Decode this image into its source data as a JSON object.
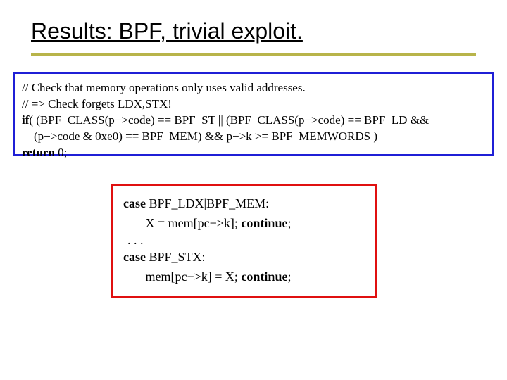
{
  "title": "Results: BPF, trivial exploit.",
  "blue": {
    "c1": "// Check that memory operations only uses valid addresses.",
    "c2": "// => Check forgets LDX,STX!",
    "if": "if",
    "cond1": "( (BPF_CLASS(p−>code) == BPF_ST || (BPF_CLASS(p−>code) == BPF_LD &&",
    "cond2": "    (p−>code & 0xe0) == BPF_MEM) && p−>k >= BPF_MEMWORDS )",
    "ret": "return",
    "retv": " 0;"
  },
  "red": {
    "case": "case",
    "c1": " BPF_LDX|BPF_MEM:",
    "l1a": "       X = mem[pc−>k]; ",
    "cont": "continue",
    "semi": ";",
    "dots": ". . .",
    "c2": " BPF_STX:",
    "l2a": "       mem[pc−>k] = X; "
  }
}
